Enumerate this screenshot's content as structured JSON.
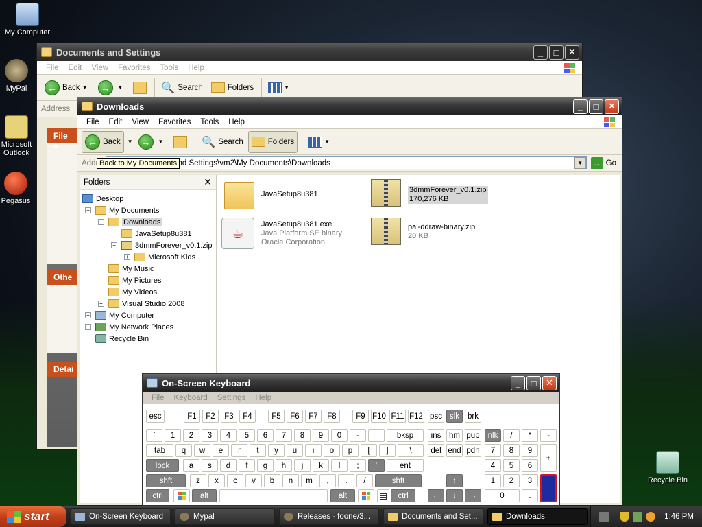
{
  "desktop": {
    "icons": [
      "My Computer",
      "MyPal",
      "Microsoft Outlook",
      "Pegasus",
      "Recycle Bin"
    ]
  },
  "docs_window": {
    "title": "Documents and Settings",
    "menu": [
      "File",
      "Edit",
      "View",
      "Favorites",
      "Tools",
      "Help"
    ],
    "back": "Back",
    "search": "Search",
    "folders": "Folders",
    "address_label": "Address",
    "task_headers": [
      "File a",
      "Othe",
      "Detai"
    ]
  },
  "downloads_window": {
    "title": "Downloads",
    "menu": [
      "File",
      "Edit",
      "View",
      "Favorites",
      "Tools",
      "Help"
    ],
    "back": "Back",
    "search": "Search",
    "folders": "Folders",
    "tooltip": "Back to My Documents",
    "address_label": "Addre",
    "address": "E:\\Documents and Settings\\vm2\\My Documents\\Downloads",
    "go": "Go",
    "folders_pane_title": "Folders",
    "tree": [
      {
        "label": "Desktop"
      },
      {
        "label": "My Documents"
      },
      {
        "label": "Downloads"
      },
      {
        "label": "JavaSetup8u381"
      },
      {
        "label": "3dmmForever_v0.1.zip"
      },
      {
        "label": "Microsoft Kids"
      },
      {
        "label": "My Music"
      },
      {
        "label": "My Pictures"
      },
      {
        "label": "My Videos"
      },
      {
        "label": "Visual Studio 2008"
      },
      {
        "label": "My Computer"
      },
      {
        "label": "My Network Places"
      },
      {
        "label": "Recycle Bin"
      }
    ],
    "files": [
      {
        "name": "JavaSetup8u381",
        "sub1": "",
        "sub2": ""
      },
      {
        "name": "3dmmForever_v0.1.zip",
        "sub1": "170,276 KB",
        "sub2": ""
      },
      {
        "name": "JavaSetup8u381.exe",
        "sub1": "Java Platform SE binary",
        "sub2": "Oracle Corporation"
      },
      {
        "name": "pal-ddraw-binary.zip",
        "sub1": "20 KB",
        "sub2": ""
      }
    ]
  },
  "osk": {
    "title": "On-Screen Keyboard",
    "menu": [
      "File",
      "Keyboard",
      "Settings",
      "Help"
    ],
    "rows": [
      [
        "esc",
        "F1",
        "F2",
        "F3",
        "F4",
        "F5",
        "F6",
        "F7",
        "F8",
        "F9",
        "F10",
        "F11",
        "F12",
        "psc",
        "slk",
        "brk"
      ],
      [
        "`",
        "1",
        "2",
        "3",
        "4",
        "5",
        "6",
        "7",
        "8",
        "9",
        "0",
        "-",
        "=",
        "bksp",
        "ins",
        "hm",
        "pup",
        "nlk",
        "/",
        "*",
        "-"
      ],
      [
        "tab",
        "q",
        "w",
        "e",
        "r",
        "t",
        "y",
        "u",
        "i",
        "o",
        "p",
        "[",
        "]",
        "\\",
        "del",
        "end",
        "pdn",
        "7",
        "8",
        "9",
        "+"
      ],
      [
        "lock",
        "a",
        "s",
        "d",
        "f",
        "g",
        "h",
        "j",
        "k",
        "l",
        ";",
        "'",
        "ent",
        "4",
        "5",
        "6"
      ],
      [
        "shft",
        "z",
        "x",
        "c",
        "v",
        "b",
        "n",
        "m",
        ",",
        ".",
        "/",
        "shft",
        "1",
        "2",
        "3"
      ],
      [
        "ctrl",
        "alt",
        "alt",
        "ctrl",
        "0",
        "."
      ]
    ]
  },
  "taskbar": {
    "start": "start",
    "tasks": [
      "On-Screen Keyboard",
      "Mypal",
      "Releases · foone/3...",
      "Documents and Set...",
      "Downloads"
    ],
    "clock": "1:46 PM"
  }
}
